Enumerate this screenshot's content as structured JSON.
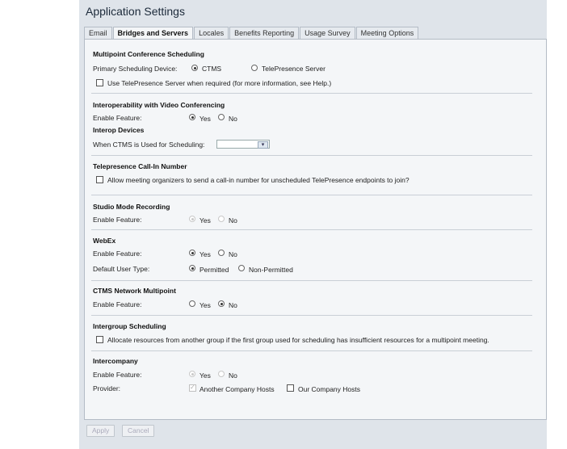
{
  "app": {
    "title": "Application Settings"
  },
  "tabs": [
    {
      "label": "Email"
    },
    {
      "label": "Bridges and Servers"
    },
    {
      "label": "Locales"
    },
    {
      "label": "Benefits Reporting"
    },
    {
      "label": "Usage Survey"
    },
    {
      "label": "Meeting Options"
    }
  ],
  "multipoint": {
    "heading": "Multipoint Conference Scheduling",
    "device_label": "Primary Scheduling Device:",
    "opt_ctms": "CTMS",
    "opt_tps": "TelePresence Server",
    "use_tps_label": "Use TelePresence Server when required (for more information, see Help.)"
  },
  "interop": {
    "heading": "Interoperability with Video Conferencing",
    "enable_label": "Enable Feature:",
    "yes": "Yes",
    "no": "No",
    "devices_heading": "Interop Devices",
    "ctms_label": "When CTMS is Used for Scheduling:",
    "ctms_value": ""
  },
  "callin": {
    "heading": "Telepresence Call-In Number",
    "allow_label": "Allow meeting organizers to send a call-in number for unscheduled TelePresence endpoints to join?"
  },
  "studio": {
    "heading": "Studio Mode Recording",
    "enable_label": "Enable Feature:",
    "yes": "Yes",
    "no": "No"
  },
  "webex": {
    "heading": "WebEx",
    "enable_label": "Enable Feature:",
    "yes": "Yes",
    "no": "No",
    "user_type_label": "Default User Type:",
    "permitted": "Permitted",
    "non_permitted": "Non-Permitted"
  },
  "ctms_net": {
    "heading": "CTMS Network Multipoint",
    "enable_label": "Enable Feature:",
    "yes": "Yes",
    "no": "No"
  },
  "intergroup": {
    "heading": "Intergroup Scheduling",
    "allocate_label": "Allocate resources from another group if the first group used for scheduling has insufficient resources for a multipoint meeting."
  },
  "intercompany": {
    "heading": "Intercompany",
    "enable_label": "Enable Feature:",
    "yes": "Yes",
    "no": "No",
    "provider_label": "Provider:",
    "another": "Another Company Hosts",
    "our": "Our Company Hosts"
  },
  "buttons": {
    "apply": "Apply",
    "cancel": "Cancel"
  }
}
